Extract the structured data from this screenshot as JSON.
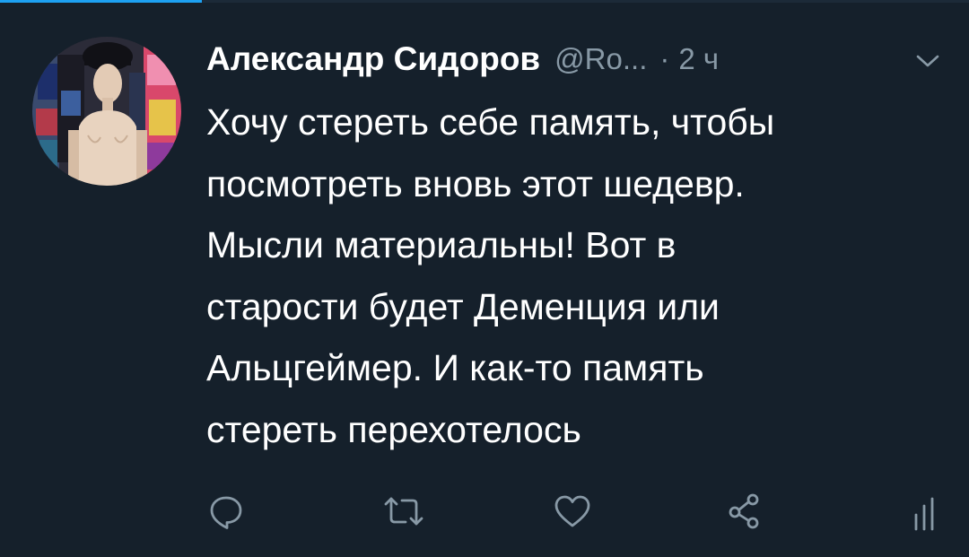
{
  "tweet": {
    "author_name": "Александр Сидоров",
    "handle": "@Ro...",
    "separator": "·",
    "time": "2 ч",
    "text_lines": [
      "Хочу стереть себе память, чтобы",
      "посмотреть вновь этот шедевр.",
      "Мысли материальны! Вот в",
      "старости будет Деменция или",
      "Альцгеймер. И как-то память",
      "стереть перехотелось"
    ]
  },
  "icons": {
    "menu": "chevron-down-icon",
    "reply": "reply-icon",
    "retweet": "retweet-icon",
    "like": "heart-icon",
    "share": "share-icon",
    "analytics": "analytics-icon"
  },
  "colors": {
    "background": "#15202b",
    "text": "#ffffff",
    "secondary_text": "#8899a6",
    "accent": "#1da1f2"
  }
}
